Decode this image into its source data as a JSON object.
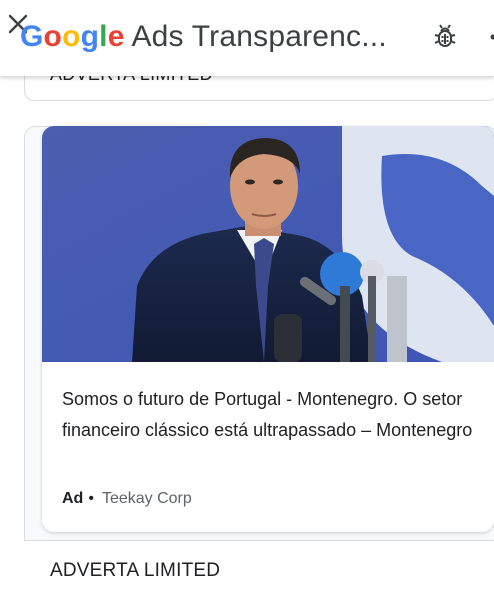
{
  "header": {
    "logo_letters": [
      {
        "char": "G",
        "color": "#4285F4"
      },
      {
        "char": "o",
        "color": "#EA4335"
      },
      {
        "char": "o",
        "color": "#FBBC05"
      },
      {
        "char": "g",
        "color": "#4285F4"
      },
      {
        "char": "l",
        "color": "#34A853"
      },
      {
        "char": "e",
        "color": "#EA4335"
      }
    ],
    "title_rest": " Ads Transparenc...",
    "close_icon": "close-icon",
    "bug_icon": "bug-report-icon"
  },
  "previous_advertiser": {
    "name": "ADVERTA LIMITED"
  },
  "ad": {
    "image_description_icon": "ad-image",
    "text": "Somos o futuro de Portugal - Montenegro. O setor financeiro clássico está ultrapassado – Montenegro",
    "badge": "Ad",
    "separator": "•",
    "advertiser": "Teekay Corp"
  },
  "next_advertiser": {
    "name": "ADVERTA LIMITED"
  },
  "colors": {
    "accent_blue": "#4285F4",
    "text": "#202124",
    "secondary_text": "#5f6368",
    "border": "#dadce0"
  }
}
